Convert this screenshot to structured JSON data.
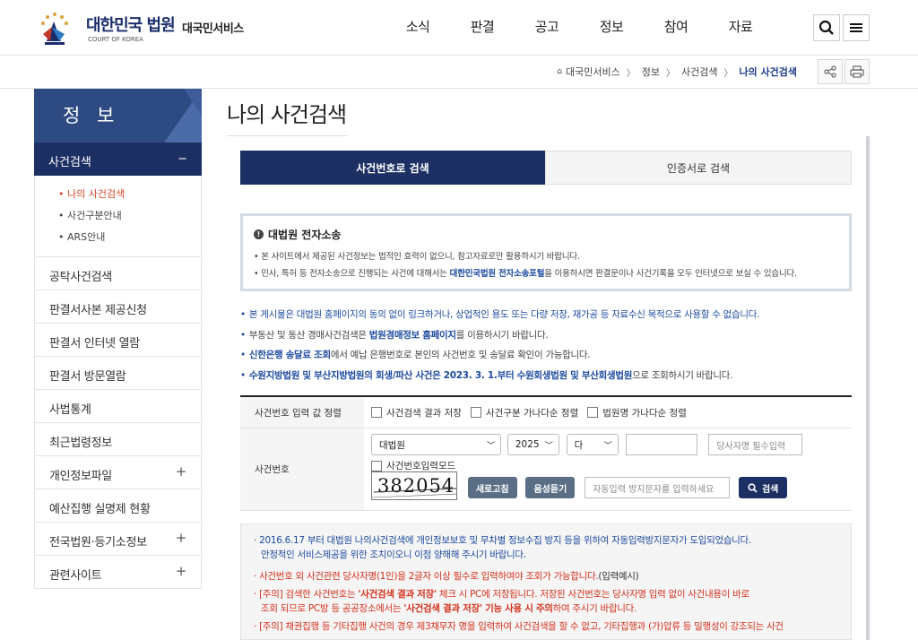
{
  "header": {
    "logo_title": "대한민국 법원",
    "logo_sub": "COURT OF KOREA",
    "service_name": "대국민서비스",
    "gnb": [
      "소식",
      "판결",
      "공고",
      "정보",
      "참여",
      "자료"
    ]
  },
  "breadcrumb": {
    "items": [
      "대국민서비스",
      "정보",
      "사건검색",
      "나의 사건검색"
    ]
  },
  "sidebar": {
    "title": "정 보",
    "active_menu": "사건검색",
    "active_toggle": "−",
    "sub_items": [
      "• 나의 사건검색",
      "• 사건구분안내",
      "• ARS안내"
    ],
    "menu": [
      {
        "label": "공탁사건검색",
        "toggle": ""
      },
      {
        "label": "판결서사본 제공신청",
        "toggle": ""
      },
      {
        "label": "판결서 인터넷 열람",
        "toggle": ""
      },
      {
        "label": "판결서 방문열람",
        "toggle": ""
      },
      {
        "label": "사법통계",
        "toggle": ""
      },
      {
        "label": "최근법령정보",
        "toggle": ""
      },
      {
        "label": "개인정보파일",
        "toggle": "+"
      },
      {
        "label": "예산집행 실명제 현황",
        "toggle": ""
      },
      {
        "label": "전국법원·등기소정보",
        "toggle": "+"
      },
      {
        "label": "관련사이트",
        "toggle": "+"
      }
    ]
  },
  "main": {
    "title": "나의 사건검색",
    "tabs": [
      "사건번호로 검색",
      "인증서로 검색"
    ]
  },
  "notice": {
    "title": "대법원 전자소송",
    "line1": "• 본 사이트에서 제공된 사건정보는 법적인 효력이 없으니, 참고자료로만 활용하시기 바랍니다.",
    "line2_pre": "• 민사, 특허 등 전자소송으로 진행되는 사건에 대해서는 ",
    "line2_link": "대한민국법원 전자소송포털",
    "line2_post": "을 이용하시면 판결문이나 사건기록을 모두 인터넷으로 보실 수 있습니다."
  },
  "bullets": {
    "b1": "본 게시물은 대법원 홈페이지의 동의 없이 링크하거나, 상업적인 용도 또는 다량 저장, 재가공 등 자료수신 목적으로 사용할 수 없습니다.",
    "b2_pre": "부동산 및 동산 경매사건검색은 ",
    "b2_link": "법원경매정보 홈페이지",
    "b2_post": "를 이용하시기 바랍니다.",
    "b3_link": "신한은행 송달료 조회",
    "b3_post": "에서 예납 은행번호로 본인의 사건번호 및 송달료 확인이 가능합니다.",
    "b4_pre": "수원지방법원 및 부산지방법원의 회생/파산 사건은 2023. 3. 1.부터 수원회생법원 및 부산회생법원",
    "b4_post": "으로 조회하시기 바랍니다."
  },
  "form": {
    "sort_label": "사건번호 입력 값 정렬",
    "sort_options": [
      "사건검색 결과 저장",
      "사건구분 가나다순 정렬",
      "법원명 가나다순 정렬"
    ],
    "case_label": "사건번호",
    "court_value": "대법원",
    "year_value": "2025",
    "type_value": "다",
    "number_value": "",
    "party_placeholder": "당사자명 필수입력",
    "input_mode_label": "사건번호입력모드",
    "captcha_text": "382054",
    "refresh_label": "새로고침",
    "audio_label": "음성듣기",
    "captcha_placeholder": "자동입력 방지문자를 입력하세요",
    "search_label": "검색"
  },
  "info": {
    "l1": "· 2016.6.17 부터 대법원 나의사건검색에 개인정보보호 및 무차별 정보수집 방지 등을 위하여 자동입력방지문자가 도입되었습니다.",
    "l2": "안정적인 서비스제공을 위한 조치이오니 이점 양해해 주시기 바랍니다.",
    "l3_red": "· 사건번호 외 사건관련 당사자명(1인)을 2글자 이상 필수로 입력하여야 조회가 가능합니다.",
    "l3_dark": "(입력예시)",
    "l4_a": "· [주의] 검색한 사건번호는 ",
    "l4_b": "'사건검색 결과 저장'",
    "l4_c": " 체크 시 PC에 저장됩니다. 저장된 사건번호는 당사자명 입력 없이 사건내용이 바로",
    "l5_a": "조회 되므로 PC방 등 공공장소에서는 ",
    "l5_b": "'사건검색 결과 저장' 기능 사용 시 주의",
    "l5_c": "하여 주시기 바랍니다.",
    "l6": "· [주의] 채권집행 등 기타집행 사건의 경우 제3채무자 명을 입력하여 사건검색을 할 수 없고, 기타집행과 (가)압류 등 밀행성이 강조되는 사건"
  },
  "colors": {
    "navy": "#1d3063",
    "sidebar_title": "#2d4a82",
    "link_blue": "#1e4ba0",
    "warning_red": "#d4321e",
    "active_sub": "#d4452c"
  }
}
